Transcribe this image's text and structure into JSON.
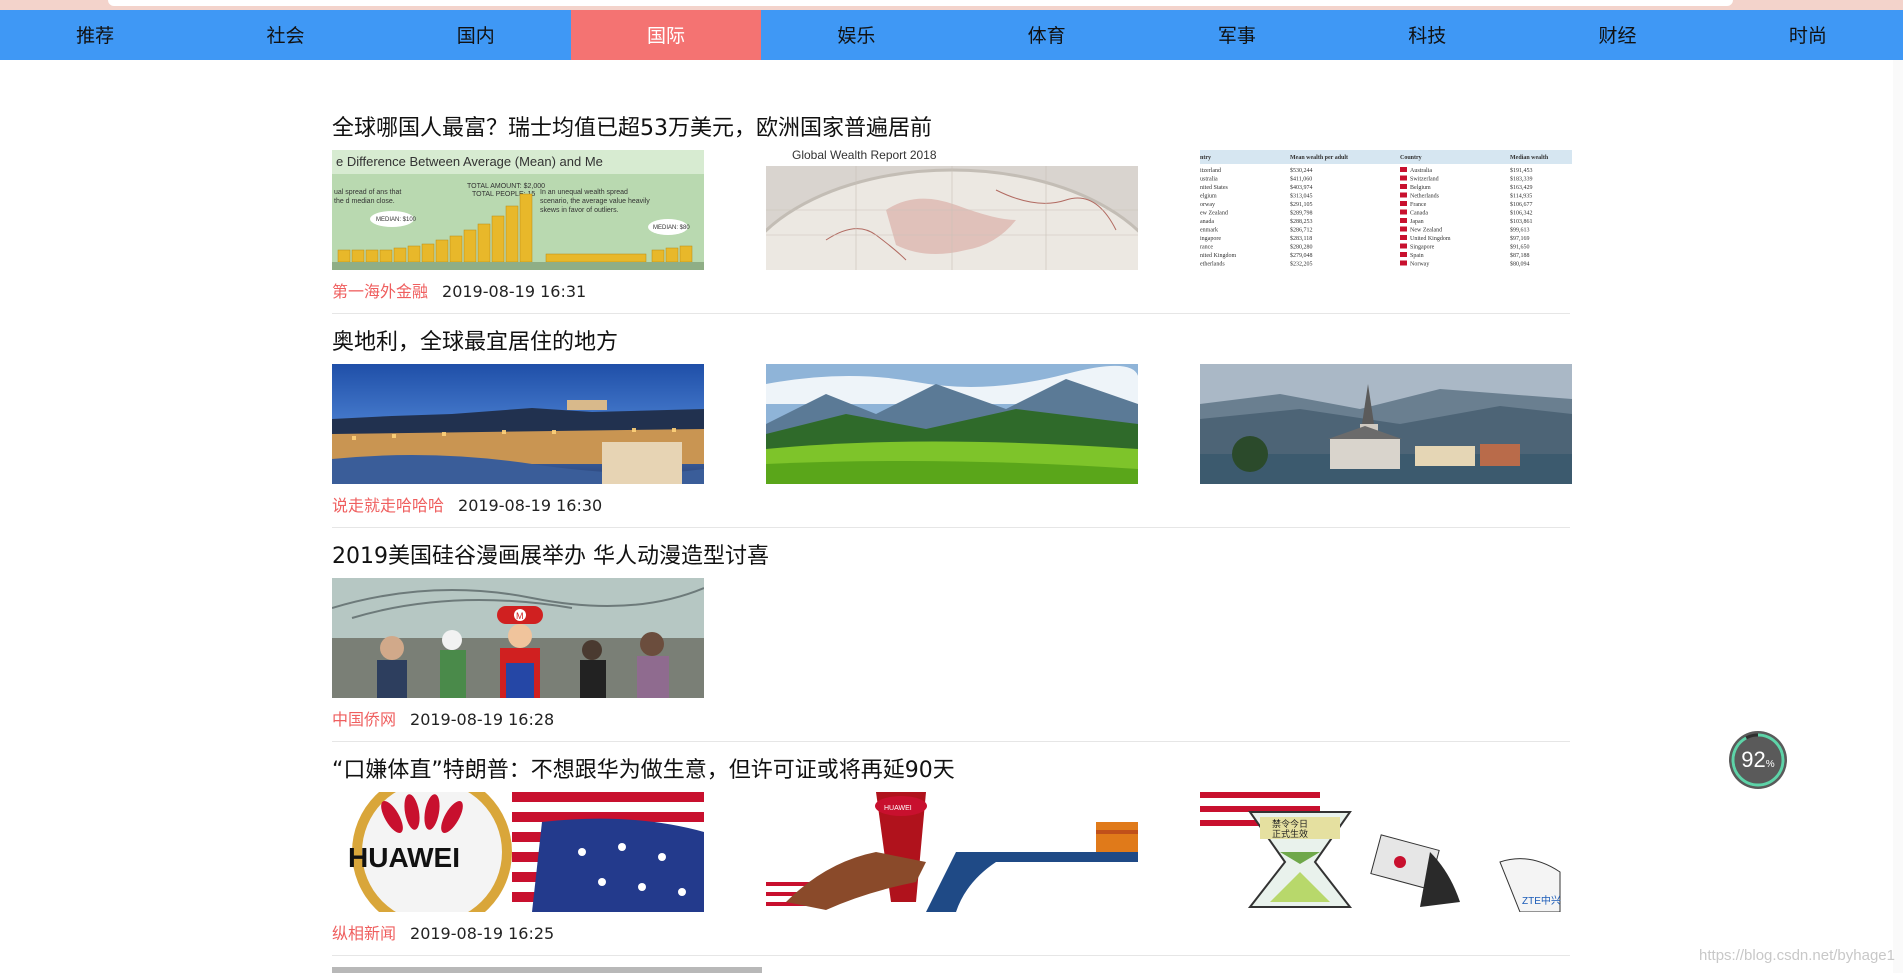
{
  "nav": {
    "items": [
      {
        "label": "推荐"
      },
      {
        "label": "社会"
      },
      {
        "label": "国内"
      },
      {
        "label": "国际"
      },
      {
        "label": "娱乐"
      },
      {
        "label": "体育"
      },
      {
        "label": "军事"
      },
      {
        "label": "科技"
      },
      {
        "label": "财经"
      },
      {
        "label": "时尚"
      }
    ],
    "active_label": "国际",
    "active_color": "#f47372",
    "bar_color": "#3f98f5"
  },
  "articles": [
    {
      "title": "全球哪国人最富？瑞士均值已超53万美元，欧洲国家普遍居前",
      "source": "第一海外金融",
      "time": "2019-08-19 16:31",
      "images": [
        {
          "header": "e Difference Between Average (Mean) and Me",
          "total_amount": "TOTAL AMOUNT: $2,000",
          "total_people": "TOTAL PEOPLE: 15",
          "median_left": "MEDIAN: $100",
          "median_right": "MEDIAN: $80",
          "text_left": "ual spread of ans that the d median close.",
          "text_right": "In an unequal wealth spread scenario, the average value heavily skews in favor of outliers."
        },
        {
          "title": "Global Wealth Report 2018"
        },
        {
          "headers": [
            "ntry",
            "Mean wealth per adult",
            "Country",
            "Median wealth"
          ],
          "rows": [
            [
              "itzerland",
              "$530,244",
              "Australia",
              "$191,453"
            ],
            [
              "ustralia",
              "$411,060",
              "Switzerland",
              "$183,339"
            ],
            [
              "nited States",
              "$403,974",
              "Belgium",
              "$163,429"
            ],
            [
              "elgium",
              "$313,045",
              "Netherlands",
              "$114,935"
            ],
            [
              "orway",
              "$291,105",
              "France",
              "$106,677"
            ],
            [
              "ew Zealand",
              "$289,798",
              "Canada",
              "$106,342"
            ],
            [
              "anada",
              "$288,253",
              "Japan",
              "$103,861"
            ],
            [
              "enmark",
              "$286,712",
              "New Zealand",
              "$99,613"
            ],
            [
              "ingapore",
              "$283,118",
              "United Kingdom",
              "$97,169"
            ],
            [
              "rance",
              "$280,280",
              "Singapore",
              "$91,650"
            ],
            [
              "nited Kingdom",
              "$279,048",
              "Spain",
              "$87,188"
            ],
            [
              "etherlands",
              "$232,205",
              "Norway",
              "$80,094"
            ]
          ]
        }
      ]
    },
    {
      "title": "奥地利，全球最宜居住的地方",
      "source": "说走就走哈哈哈",
      "time": "2019-08-19 16:30",
      "images": [
        {},
        {},
        {}
      ]
    },
    {
      "title": "2019美国硅谷漫画展举办 华人动漫造型讨喜",
      "source": "中国侨网",
      "time": "2019-08-19 16:28",
      "images": [
        {
          "cap_letter": "M"
        }
      ]
    },
    {
      "title": "“口嫌体直”特朗普：不想跟华为做生意，但许可证或将再延90天",
      "source": "纵相新闻",
      "time": "2019-08-19 16:25",
      "images": [
        {
          "brand": "HUAWEI"
        },
        {
          "brand": "HUAWEI"
        },
        {
          "sign_line1": "禁令今日",
          "sign_line2": "正式生效",
          "zte": "ZTE中兴"
        }
      ]
    }
  ],
  "scroll_gauge": {
    "value": "92",
    "unit": "%"
  },
  "watermark": "https://blog.csdn.net/byhage1"
}
